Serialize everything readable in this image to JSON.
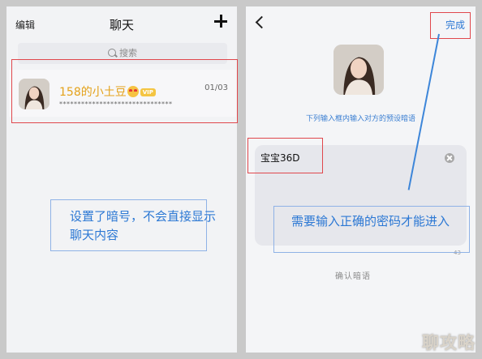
{
  "left": {
    "edit_label": "编辑",
    "title": "聊天",
    "search_placeholder": "搜索",
    "chat": {
      "name": "158的小土豆",
      "vip_badge": "VIP",
      "date": "01/03",
      "preview": "*******************************"
    },
    "annotation": [
      "设置了暗号，不会直接显示",
      "聊天内容"
    ]
  },
  "right": {
    "done_label": "完成",
    "hint": "下列输入框内输入对方的预设暗语",
    "input_value": "宝宝36D",
    "counter": "43",
    "confirm_label": "确认暗语",
    "annotation": "需要输入正确的密码才能进入"
  },
  "watermark": "聊攻略",
  "colors": {
    "annotation_blue": "#2c78d4",
    "highlight_red": "#e0474c",
    "name_gold": "#e4a21b"
  }
}
